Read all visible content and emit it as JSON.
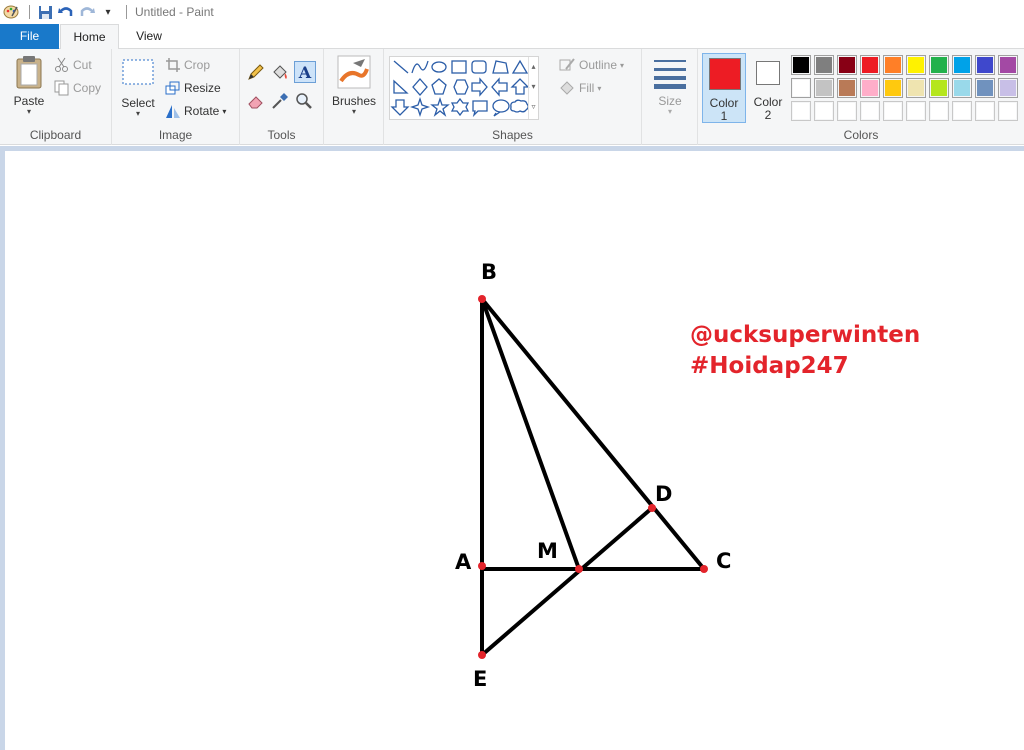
{
  "window": {
    "title": "Untitled - Paint",
    "customize_label": "▾"
  },
  "tabs": {
    "file": "File",
    "home": "Home",
    "view": "View"
  },
  "clipboard": {
    "label": "Clipboard",
    "paste": "Paste",
    "cut": "Cut",
    "copy": "Copy"
  },
  "image": {
    "label": "Image",
    "select": "Select",
    "crop": "Crop",
    "resize": "Resize",
    "rotate": "Rotate"
  },
  "tools": {
    "label": "Tools",
    "text_tool": "A"
  },
  "brushes": {
    "label": "Brushes"
  },
  "shapes": {
    "label": "Shapes",
    "outline": "Outline",
    "fill": "Fill"
  },
  "size": {
    "label": "Size"
  },
  "colors": {
    "label": "Colors",
    "color1_label": "Color",
    "color1_num": "1",
    "color2_label": "Color",
    "color2_num": "2",
    "color1_value": "#ed1c24",
    "color2_value": "#ffffff",
    "palette_row1": [
      "#000000",
      "#7f7f7f",
      "#880015",
      "#ed1c24",
      "#ff7f27",
      "#fff200",
      "#22b14c",
      "#00a2e8",
      "#3f48cc",
      "#a349a4"
    ],
    "palette_row2": [
      "#ffffff",
      "#c3c3c3",
      "#b97a57",
      "#ffaec9",
      "#ffc90e",
      "#efe4b0",
      "#b5e61d",
      "#99d9ea",
      "#7092be",
      "#c8bfe7"
    ],
    "palette_row3": [
      "#ffffff",
      "#ffffff",
      "#ffffff",
      "#ffffff",
      "#ffffff",
      "#ffffff",
      "#ffffff",
      "#ffffff",
      "#ffffff",
      "#ffffff"
    ]
  },
  "drawing": {
    "labels": {
      "B": "B",
      "D": "D",
      "A": "A",
      "M": "M",
      "C": "C",
      "E": "E"
    },
    "watermark_line1": "@ucksuperwinten",
    "watermark_line2": "#Hoidap247",
    "watermark_color": "#e3242b"
  }
}
